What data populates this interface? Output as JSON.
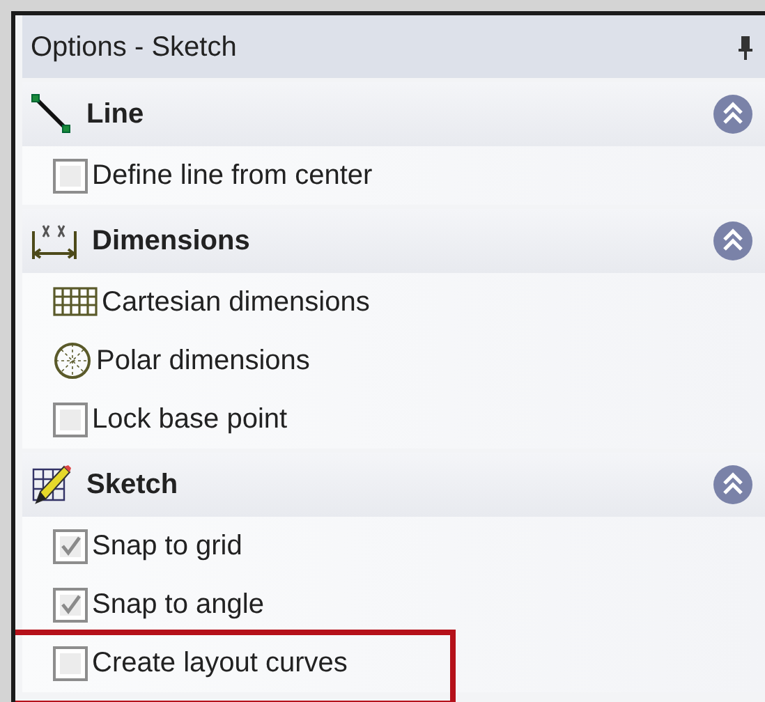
{
  "panel": {
    "title": "Options - Sketch",
    "pinned": true
  },
  "sections": [
    {
      "title": "Line",
      "expanded": true,
      "items": [
        {
          "kind": "checkbox",
          "label": "Define line from center",
          "checked": false,
          "highlighted": false
        }
      ]
    },
    {
      "title": "Dimensions",
      "expanded": true,
      "items": [
        {
          "kind": "option",
          "label": "Cartesian dimensions",
          "highlighted": false
        },
        {
          "kind": "option",
          "label": "Polar dimensions",
          "highlighted": false
        },
        {
          "kind": "checkbox",
          "label": "Lock base point",
          "checked": false,
          "highlighted": false
        }
      ]
    },
    {
      "title": "Sketch",
      "expanded": true,
      "items": [
        {
          "kind": "checkbox",
          "label": "Snap to grid",
          "checked": true,
          "highlighted": false
        },
        {
          "kind": "checkbox",
          "label": "Snap to angle",
          "checked": true,
          "highlighted": false
        },
        {
          "kind": "checkbox",
          "label": "Create layout curves",
          "checked": false,
          "highlighted": true
        }
      ]
    }
  ]
}
